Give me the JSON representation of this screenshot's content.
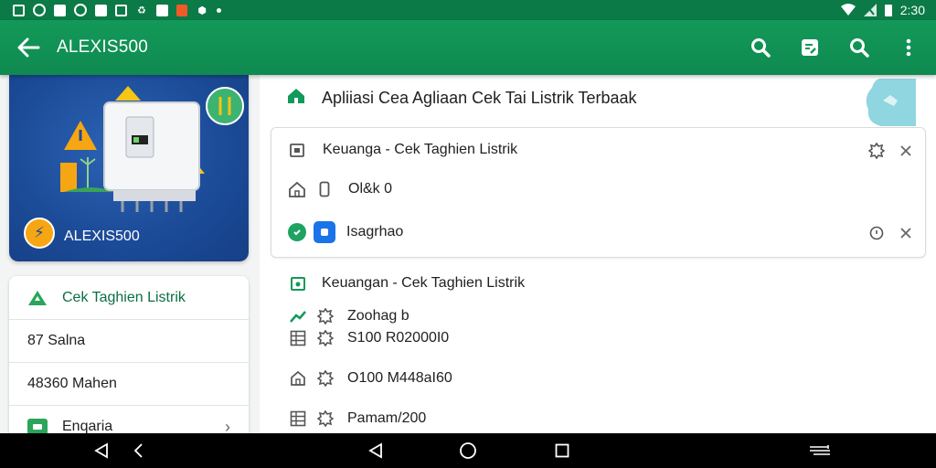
{
  "app": {
    "title": "ALEXIS500"
  },
  "status": {
    "time": "2:30"
  },
  "hero": {
    "name": "ALEXIS500"
  },
  "menu": {
    "header": "Cek Taghien Listrik",
    "items": [
      {
        "label": "87 Salna"
      },
      {
        "label": "48360 Mahen"
      },
      {
        "label": "Enqaria"
      }
    ]
  },
  "panel": {
    "heading": "Apliiasi Cea Agliaan Cek Tai Listrik Terbaak",
    "card": {
      "title": "Keuanga - Cek Taghien Listrik",
      "row1_value": "Ol&k 0",
      "row2_value": "Isagrhao"
    },
    "section": {
      "title": "Keuangan - Cek Taghien Listrik",
      "rows": [
        {
          "value": "Zoohag b"
        },
        {
          "value": "S100 R02000I0"
        },
        {
          "value": "O100 M448aI60"
        },
        {
          "value": "Pamam/200"
        }
      ]
    }
  },
  "colors": {
    "primary": "#13995a",
    "status_bar": "#0b7a47",
    "hero_blue": "#1b4a96",
    "accent_blue": "#1a73e8"
  }
}
